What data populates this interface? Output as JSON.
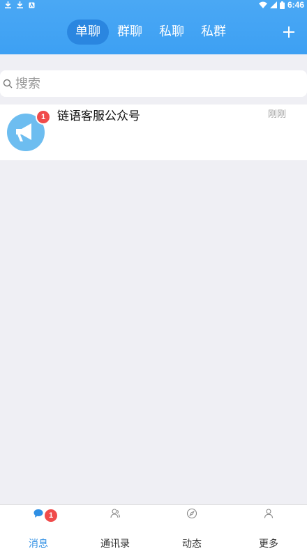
{
  "status_bar": {
    "time": "6:46"
  },
  "header": {
    "tabs": [
      {
        "label": "单聊",
        "active": true
      },
      {
        "label": "群聊",
        "active": false
      },
      {
        "label": "私聊",
        "active": false
      },
      {
        "label": "私群",
        "active": false
      }
    ],
    "add_icon": "plus-icon"
  },
  "search": {
    "placeholder": "搜索"
  },
  "conversations": [
    {
      "name": "链语客服公众号",
      "time": "刚刚",
      "unread": "1",
      "avatar_icon": "megaphone-icon"
    }
  ],
  "bottom_nav": {
    "items": [
      {
        "label": "消息",
        "icon": "chat-bubble-icon",
        "active": true
      },
      {
        "label": "通讯录",
        "icon": "contacts-icon",
        "active": false
      },
      {
        "label": "动态",
        "icon": "compass-icon",
        "active": false
      },
      {
        "label": "更多",
        "icon": "person-icon",
        "active": false
      }
    ],
    "messages_badge": "1"
  },
  "colors": {
    "header": "#3da0f3",
    "active_tab": "#2a86e0",
    "badge": "#f04b4b",
    "active_nav": "#2f8fe4",
    "background": "#efeff4"
  }
}
